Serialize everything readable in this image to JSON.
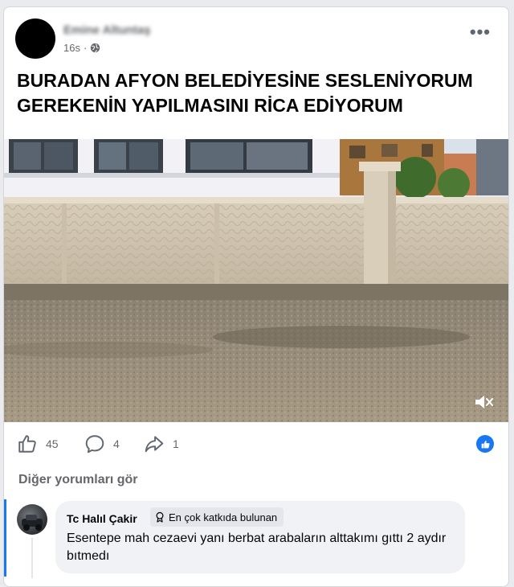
{
  "post": {
    "author": "Emine Altuntaş",
    "time": "16s",
    "dot": "·",
    "text": "BURADAN AFYON BELEDİYESİNE SESLENİYORUM\nGEREKENİN YAPILMASINI RİCA EDİYORUM"
  },
  "actions": {
    "likes": "45",
    "comments": "4",
    "shares": "1"
  },
  "comments_section": {
    "see_more": "Diğer yorumları gör",
    "comment": {
      "author": "Tc Halıl Çakir",
      "badge": "En çok katkıda bulunan",
      "text": "Esentepe mah cezaevi yanı berbat arabaların alttakımı gıttı 2 aydır bıtmedı"
    }
  },
  "colors": {
    "accent": "#1877f2",
    "secondary_text": "#65676b"
  },
  "icons": [
    "more-options-icon",
    "globe-icon",
    "mute-icon",
    "like-icon",
    "comment-icon",
    "share-icon",
    "like-reaction-icon",
    "top-contributor-icon"
  ]
}
